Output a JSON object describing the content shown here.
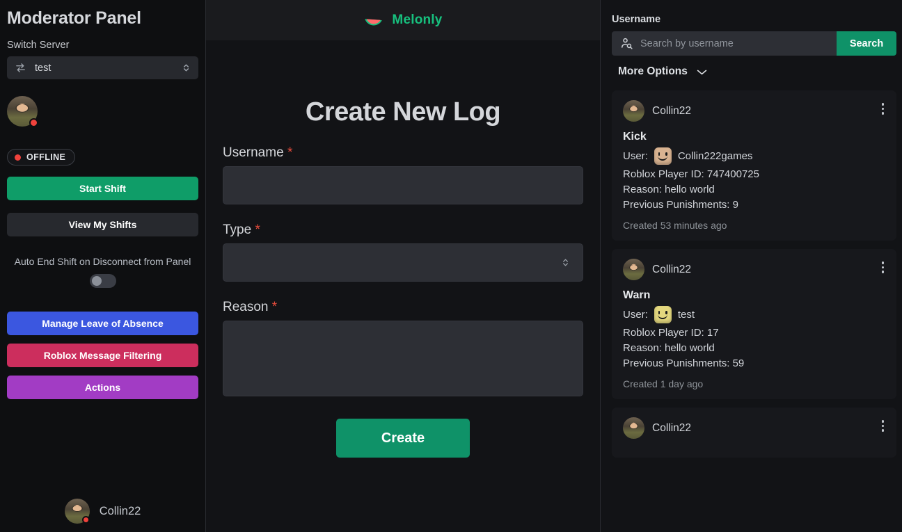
{
  "sidebar": {
    "title": "Moderator Panel",
    "switch_server_label": "Switch Server",
    "server_value": "test",
    "server_icon": "exchange-arrows-icon",
    "status_badge": "OFFLINE",
    "start_shift_label": "Start Shift",
    "view_shifts_label": "View My Shifts",
    "auto_end_label": "Auto End Shift on Disconnect from Panel",
    "auto_end_on": false,
    "manage_loa_label": "Manage Leave of Absence",
    "message_filtering_label": "Roblox Message Filtering",
    "actions_label": "Actions",
    "footer_username": "Collin22",
    "colors": {
      "start_shift": "#0f9d68",
      "view_shifts": "#27292e",
      "manage_loa": "#3b57e0",
      "message_filtering": "#cc2e5d",
      "actions": "#a23cc4",
      "status_dot": "#f0423c"
    }
  },
  "header": {
    "brand": "Melonly",
    "brand_color": "#17c07e",
    "logo_icon": "watermelon-slice-icon"
  },
  "form": {
    "title": "Create New Log",
    "required_marker": "*",
    "fields": [
      {
        "label": "Username",
        "required": true,
        "value": "",
        "type": "text"
      },
      {
        "label": "Type",
        "required": true,
        "value": "",
        "type": "select"
      },
      {
        "label": "Reason",
        "required": true,
        "value": "",
        "type": "textarea"
      }
    ],
    "submit_label": "Create",
    "submit_color": "#0f9268"
  },
  "search_panel": {
    "label": "Username",
    "placeholder": "Search by username",
    "value": "",
    "search_button": "Search",
    "search_button_color": "#0f9268",
    "search_icon": "user-search-icon",
    "more_options_label": "More Options",
    "more_options_icon": "chevron-down-icon"
  },
  "logs": [
    {
      "moderator": "Collin22",
      "type": "Kick",
      "user_label": "User:",
      "user_name": "Collin222games",
      "user_avatar_color": "#d9b391",
      "player_id_line": "Roblox Player ID: 747400725",
      "reason_line": "Reason: hello world",
      "punishments_line": "Previous Punishments: 9",
      "created": "Created 53 minutes ago",
      "menu_icon": "kebab-menu-icon"
    },
    {
      "moderator": "Collin22",
      "type": "Warn",
      "user_label": "User:",
      "user_name": "test",
      "user_avatar_color": "#e3d77e",
      "player_id_line": "Roblox Player ID: 17",
      "reason_line": "Reason: hello world",
      "punishments_line": "Previous Punishments: 59",
      "created": "Created 1 day ago",
      "menu_icon": "kebab-menu-icon"
    },
    {
      "moderator": "Collin22",
      "type": "",
      "user_label": "",
      "user_name": "",
      "user_avatar_color": "#d9b391",
      "player_id_line": "",
      "reason_line": "",
      "punishments_line": "",
      "created": "",
      "menu_icon": "kebab-menu-icon"
    }
  ]
}
